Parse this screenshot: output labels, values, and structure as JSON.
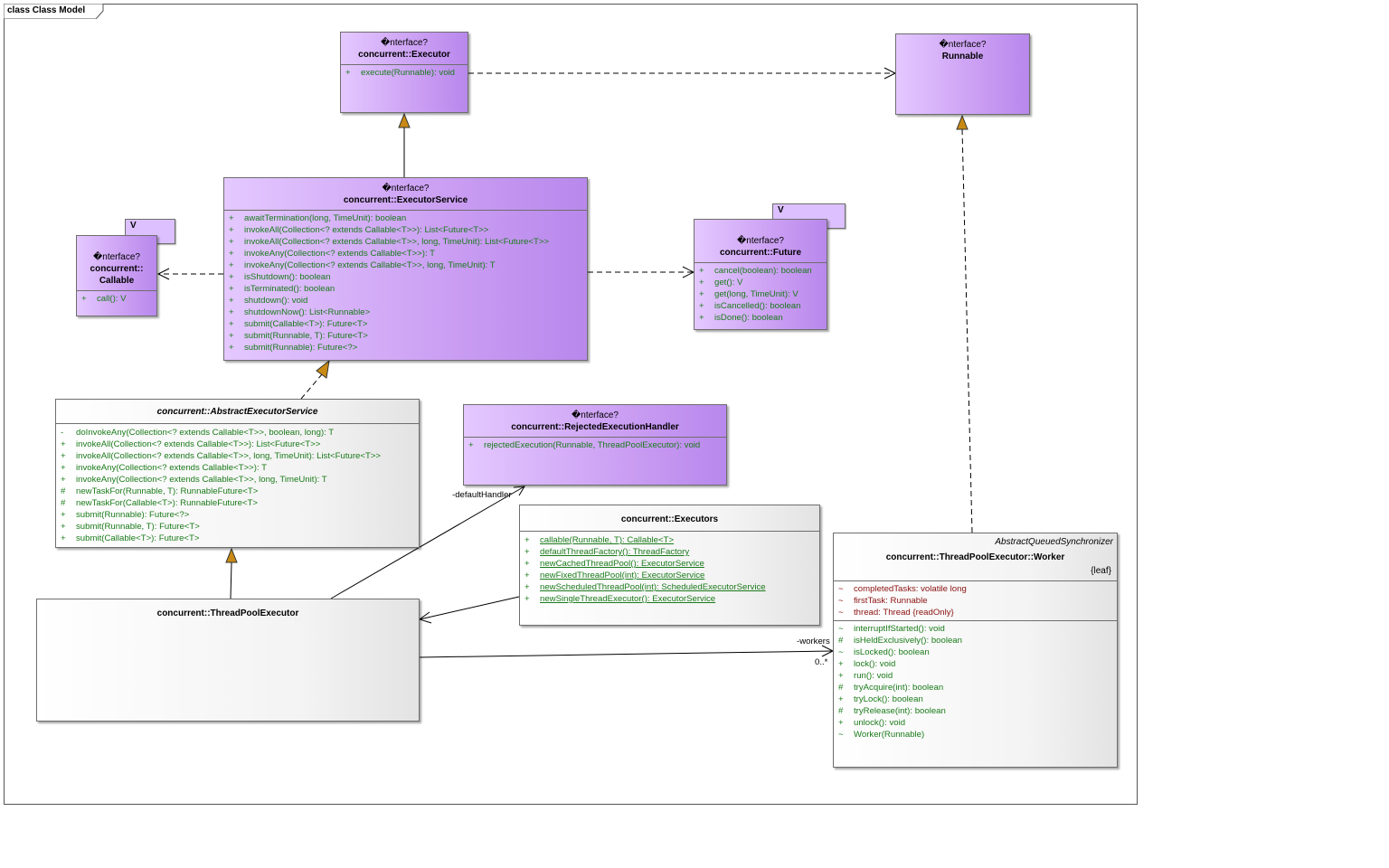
{
  "frame": {
    "label": "class Class Model"
  },
  "stereotype_interface": "«interface»",
  "classes": {
    "executor": {
      "stereotype": "�nterface?",
      "name": "concurrent::Executor",
      "ops": [
        {
          "vis": "+",
          "text": "execute(Runnable): void"
        }
      ]
    },
    "runnable": {
      "stereotype": "�nterface?",
      "name": "Runnable"
    },
    "executor_service": {
      "stereotype": "�nterface?",
      "name": "concurrent::ExecutorService",
      "ops": [
        {
          "vis": "+",
          "text": "awaitTermination(long, TimeUnit): boolean"
        },
        {
          "vis": "+",
          "text": "invokeAll(Collection<? extends Callable<T>>): List<Future<T>>"
        },
        {
          "vis": "+",
          "text": "invokeAll(Collection<? extends Callable<T>>, long, TimeUnit): List<Future<T>>"
        },
        {
          "vis": "+",
          "text": "invokeAny(Collection<? extends Callable<T>>): T"
        },
        {
          "vis": "+",
          "text": "invokeAny(Collection<? extends Callable<T>>, long, TimeUnit): T"
        },
        {
          "vis": "+",
          "text": "isShutdown(): boolean"
        },
        {
          "vis": "+",
          "text": "isTerminated(): boolean"
        },
        {
          "vis": "+",
          "text": "shutdown(): void"
        },
        {
          "vis": "+",
          "text": "shutdownNow(): List<Runnable>"
        },
        {
          "vis": "+",
          "text": "submit(Callable<T>): Future<T>"
        },
        {
          "vis": "+",
          "text": "submit(Runnable, T): Future<T>"
        },
        {
          "vis": "+",
          "text": "submit(Runnable): Future<?>"
        }
      ]
    },
    "callable": {
      "template_param": "V",
      "stereotype": "�nterface?",
      "name_line1": "concurrent::",
      "name_line2": "Callable",
      "ops": [
        {
          "vis": "+",
          "text": "call(): V"
        }
      ]
    },
    "future": {
      "template_param": "V",
      "stereotype": "�nterface?",
      "name": "concurrent::Future",
      "ops": [
        {
          "vis": "+",
          "text": "cancel(boolean): boolean"
        },
        {
          "vis": "+",
          "text": "get(): V"
        },
        {
          "vis": "+",
          "text": "get(long, TimeUnit): V"
        },
        {
          "vis": "+",
          "text": "isCancelled(): boolean"
        },
        {
          "vis": "+",
          "text": "isDone(): boolean"
        }
      ]
    },
    "abstract_executor_service": {
      "name": "concurrent::AbstractExecutorService",
      "ops": [
        {
          "vis": "-",
          "text": "doInvokeAny(Collection<? extends Callable<T>>, boolean, long): T"
        },
        {
          "vis": "+",
          "text": "invokeAll(Collection<? extends Callable<T>>): List<Future<T>>"
        },
        {
          "vis": "+",
          "text": "invokeAll(Collection<? extends Callable<T>>, long, TimeUnit): List<Future<T>>"
        },
        {
          "vis": "+",
          "text": "invokeAny(Collection<? extends Callable<T>>): T"
        },
        {
          "vis": "+",
          "text": "invokeAny(Collection<? extends Callable<T>>, long, TimeUnit): T"
        },
        {
          "vis": "#",
          "text": "newTaskFor(Runnable, T): RunnableFuture<T>"
        },
        {
          "vis": "#",
          "text": "newTaskFor(Callable<T>): RunnableFuture<T>"
        },
        {
          "vis": "+",
          "text": "submit(Runnable): Future<?>"
        },
        {
          "vis": "+",
          "text": "submit(Runnable, T): Future<T>"
        },
        {
          "vis": "+",
          "text": "submit(Callable<T>): Future<T>"
        }
      ]
    },
    "rejected_handler": {
      "stereotype": "�nterface?",
      "name": "concurrent::RejectedExecutionHandler",
      "ops": [
        {
          "vis": "+",
          "text": "rejectedExecution(Runnable, ThreadPoolExecutor): void"
        }
      ]
    },
    "executors": {
      "name": "concurrent::Executors",
      "ops": [
        {
          "vis": "+",
          "text": "callable(Runnable, T): Callable<T>"
        },
        {
          "vis": "+",
          "text": "defaultThreadFactory(): ThreadFactory"
        },
        {
          "vis": "+",
          "text": "newCachedThreadPool(): ExecutorService"
        },
        {
          "vis": "+",
          "text": "newFixedThreadPool(int): ExecutorService"
        },
        {
          "vis": "+",
          "text": "newScheduledThreadPool(int): ScheduledExecutorService"
        },
        {
          "vis": "+",
          "text": "newSingleThreadExecutor(): ExecutorService"
        }
      ]
    },
    "thread_pool_executor": {
      "name": "concurrent::ThreadPoolExecutor"
    },
    "worker": {
      "superclass": "AbstractQueuedSynchronizer",
      "name": "concurrent::ThreadPoolExecutor::Worker",
      "tag": "{leaf}",
      "attrs": [
        {
          "vis": "~",
          "text": "completedTasks: volatile long"
        },
        {
          "vis": "~",
          "text": "firstTask: Runnable"
        },
        {
          "vis": "~",
          "text": "thread: Thread {readOnly}"
        }
      ],
      "ops": [
        {
          "vis": "~",
          "text": "interruptIfStarted(): void"
        },
        {
          "vis": "#",
          "text": "isHeldExclusively(): boolean"
        },
        {
          "vis": "~",
          "text": "isLocked(): boolean"
        },
        {
          "vis": "+",
          "text": "lock(): void"
        },
        {
          "vis": "+",
          "text": "run(): void"
        },
        {
          "vis": "#",
          "text": "tryAcquire(int): boolean"
        },
        {
          "vis": "+",
          "text": "tryLock(): boolean"
        },
        {
          "vis": "#",
          "text": "tryRelease(int): boolean"
        },
        {
          "vis": "+",
          "text": "unlock(): void"
        },
        {
          "vis": "~",
          "text": "Worker(Runnable)"
        }
      ]
    }
  },
  "labels": {
    "default_handler": "-defaultHandler",
    "workers": "-workers",
    "multiplicity": "0..*"
  },
  "colors": {
    "interface_fill": "#c99cf2",
    "class_fill": "#f3f3f3",
    "operation_text": "#1a7a1a",
    "attribute_text": "#8a1010",
    "generalization_arrow": "#c88a14"
  }
}
